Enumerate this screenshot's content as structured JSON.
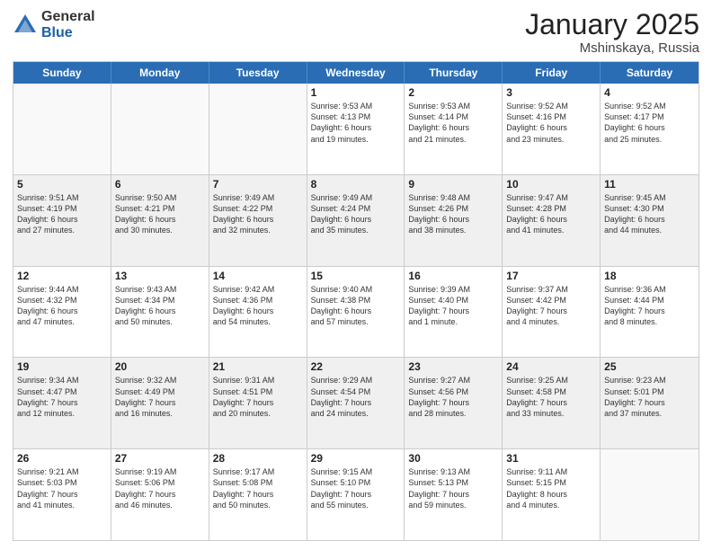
{
  "logo": {
    "general": "General",
    "blue": "Blue"
  },
  "title": "January 2025",
  "location": "Mshinskaya, Russia",
  "days": [
    "Sunday",
    "Monday",
    "Tuesday",
    "Wednesday",
    "Thursday",
    "Friday",
    "Saturday"
  ],
  "weeks": [
    [
      {
        "day": "",
        "info": ""
      },
      {
        "day": "",
        "info": ""
      },
      {
        "day": "",
        "info": ""
      },
      {
        "day": "1",
        "info": "Sunrise: 9:53 AM\nSunset: 4:13 PM\nDaylight: 6 hours\nand 19 minutes."
      },
      {
        "day": "2",
        "info": "Sunrise: 9:53 AM\nSunset: 4:14 PM\nDaylight: 6 hours\nand 21 minutes."
      },
      {
        "day": "3",
        "info": "Sunrise: 9:52 AM\nSunset: 4:16 PM\nDaylight: 6 hours\nand 23 minutes."
      },
      {
        "day": "4",
        "info": "Sunrise: 9:52 AM\nSunset: 4:17 PM\nDaylight: 6 hours\nand 25 minutes."
      }
    ],
    [
      {
        "day": "5",
        "info": "Sunrise: 9:51 AM\nSunset: 4:19 PM\nDaylight: 6 hours\nand 27 minutes."
      },
      {
        "day": "6",
        "info": "Sunrise: 9:50 AM\nSunset: 4:21 PM\nDaylight: 6 hours\nand 30 minutes."
      },
      {
        "day": "7",
        "info": "Sunrise: 9:49 AM\nSunset: 4:22 PM\nDaylight: 6 hours\nand 32 minutes."
      },
      {
        "day": "8",
        "info": "Sunrise: 9:49 AM\nSunset: 4:24 PM\nDaylight: 6 hours\nand 35 minutes."
      },
      {
        "day": "9",
        "info": "Sunrise: 9:48 AM\nSunset: 4:26 PM\nDaylight: 6 hours\nand 38 minutes."
      },
      {
        "day": "10",
        "info": "Sunrise: 9:47 AM\nSunset: 4:28 PM\nDaylight: 6 hours\nand 41 minutes."
      },
      {
        "day": "11",
        "info": "Sunrise: 9:45 AM\nSunset: 4:30 PM\nDaylight: 6 hours\nand 44 minutes."
      }
    ],
    [
      {
        "day": "12",
        "info": "Sunrise: 9:44 AM\nSunset: 4:32 PM\nDaylight: 6 hours\nand 47 minutes."
      },
      {
        "day": "13",
        "info": "Sunrise: 9:43 AM\nSunset: 4:34 PM\nDaylight: 6 hours\nand 50 minutes."
      },
      {
        "day": "14",
        "info": "Sunrise: 9:42 AM\nSunset: 4:36 PM\nDaylight: 6 hours\nand 54 minutes."
      },
      {
        "day": "15",
        "info": "Sunrise: 9:40 AM\nSunset: 4:38 PM\nDaylight: 6 hours\nand 57 minutes."
      },
      {
        "day": "16",
        "info": "Sunrise: 9:39 AM\nSunset: 4:40 PM\nDaylight: 7 hours\nand 1 minute."
      },
      {
        "day": "17",
        "info": "Sunrise: 9:37 AM\nSunset: 4:42 PM\nDaylight: 7 hours\nand 4 minutes."
      },
      {
        "day": "18",
        "info": "Sunrise: 9:36 AM\nSunset: 4:44 PM\nDaylight: 7 hours\nand 8 minutes."
      }
    ],
    [
      {
        "day": "19",
        "info": "Sunrise: 9:34 AM\nSunset: 4:47 PM\nDaylight: 7 hours\nand 12 minutes."
      },
      {
        "day": "20",
        "info": "Sunrise: 9:32 AM\nSunset: 4:49 PM\nDaylight: 7 hours\nand 16 minutes."
      },
      {
        "day": "21",
        "info": "Sunrise: 9:31 AM\nSunset: 4:51 PM\nDaylight: 7 hours\nand 20 minutes."
      },
      {
        "day": "22",
        "info": "Sunrise: 9:29 AM\nSunset: 4:54 PM\nDaylight: 7 hours\nand 24 minutes."
      },
      {
        "day": "23",
        "info": "Sunrise: 9:27 AM\nSunset: 4:56 PM\nDaylight: 7 hours\nand 28 minutes."
      },
      {
        "day": "24",
        "info": "Sunrise: 9:25 AM\nSunset: 4:58 PM\nDaylight: 7 hours\nand 33 minutes."
      },
      {
        "day": "25",
        "info": "Sunrise: 9:23 AM\nSunset: 5:01 PM\nDaylight: 7 hours\nand 37 minutes."
      }
    ],
    [
      {
        "day": "26",
        "info": "Sunrise: 9:21 AM\nSunset: 5:03 PM\nDaylight: 7 hours\nand 41 minutes."
      },
      {
        "day": "27",
        "info": "Sunrise: 9:19 AM\nSunset: 5:06 PM\nDaylight: 7 hours\nand 46 minutes."
      },
      {
        "day": "28",
        "info": "Sunrise: 9:17 AM\nSunset: 5:08 PM\nDaylight: 7 hours\nand 50 minutes."
      },
      {
        "day": "29",
        "info": "Sunrise: 9:15 AM\nSunset: 5:10 PM\nDaylight: 7 hours\nand 55 minutes."
      },
      {
        "day": "30",
        "info": "Sunrise: 9:13 AM\nSunset: 5:13 PM\nDaylight: 7 hours\nand 59 minutes."
      },
      {
        "day": "31",
        "info": "Sunrise: 9:11 AM\nSunset: 5:15 PM\nDaylight: 8 hours\nand 4 minutes."
      },
      {
        "day": "",
        "info": ""
      }
    ]
  ]
}
